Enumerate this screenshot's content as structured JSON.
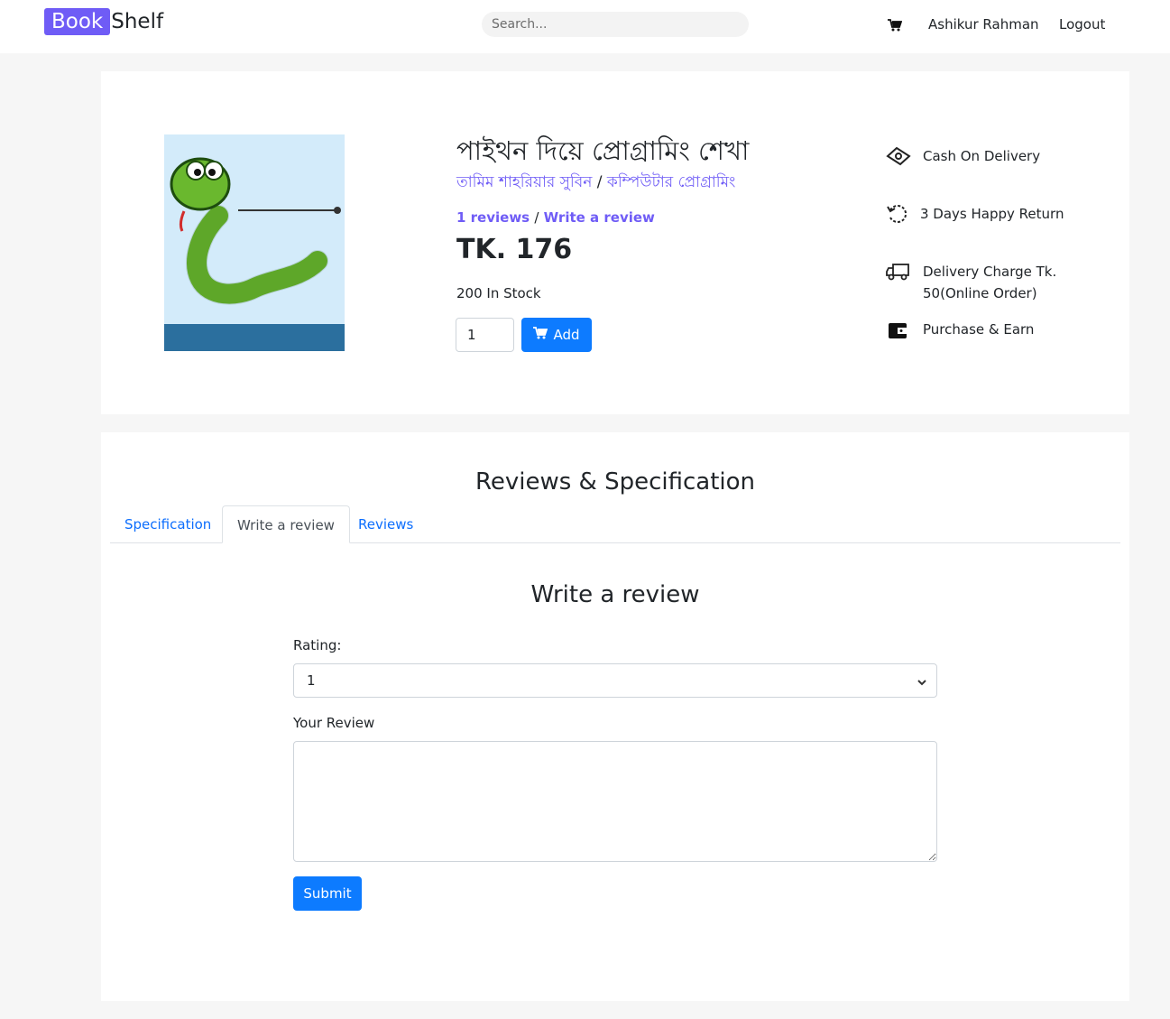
{
  "navbar": {
    "brand_part1": "Book",
    "brand_part2": "Shelf",
    "search_placeholder": "Search...",
    "user_name": "Ashikur Rahman",
    "logout_label": "Logout",
    "cart_icon": "cart-icon"
  },
  "product": {
    "title": "পাইথন দিয়ে প্রোগ্রামিং শেখা",
    "author": "তামিম শাহরিয়ার সুবিন",
    "separator": "/",
    "category": "কম্পিউটার প্রোগ্রামিং",
    "reviews_link": "1 reviews",
    "write_review_link": "Write a review",
    "price": "TK. 176",
    "stock": "200 In Stock",
    "quantity": "1",
    "add_label": "Add"
  },
  "features": [
    {
      "label": "Cash On Delivery",
      "icon": "cash-icon"
    },
    {
      "label": "3 Days Happy Return",
      "icon": "return-icon"
    },
    {
      "label": "Delivery Charge Tk. 50(Online Order)",
      "icon": "truck-icon"
    },
    {
      "label": "Purchase & Earn",
      "icon": "wallet-icon"
    }
  ],
  "reviews_section": {
    "title": "Reviews & Specification",
    "tabs": [
      {
        "label": "Specification",
        "active": false
      },
      {
        "label": "Write a review",
        "active": true
      },
      {
        "label": "Reviews",
        "active": false
      }
    ],
    "form": {
      "title": "Write a review",
      "rating_label": "Rating:",
      "rating_value": "1",
      "review_label": "Your Review",
      "review_value": "",
      "submit_label": "Submit"
    }
  },
  "colors": {
    "brand": "#6f5cf6",
    "primary_button": "#0d7bff",
    "tab_link": "#0d6efd",
    "page_bg": "#f6f6f6"
  }
}
